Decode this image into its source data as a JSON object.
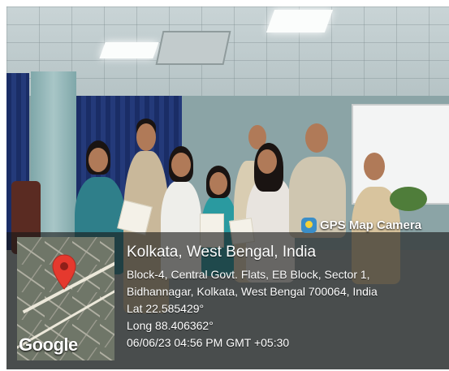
{
  "overlay": {
    "app_name": "GPS Map Camera",
    "app_icon": "gps-map-camera-icon",
    "location_title": "Kolkata, West Bengal, India",
    "address_line_1": "Block-4, Central Govt. Flats, EB Block, Sector 1,",
    "address_line_2": "Bidhannagar, Kolkata, West Bengal 700064, India",
    "latitude": "Lat 22.585429°",
    "longitude": "Long 88.406362°",
    "datetime": "06/06/23 04:56 PM GMT +05:30",
    "map_brand": "Google",
    "map_pin_color": "#e5392e"
  }
}
